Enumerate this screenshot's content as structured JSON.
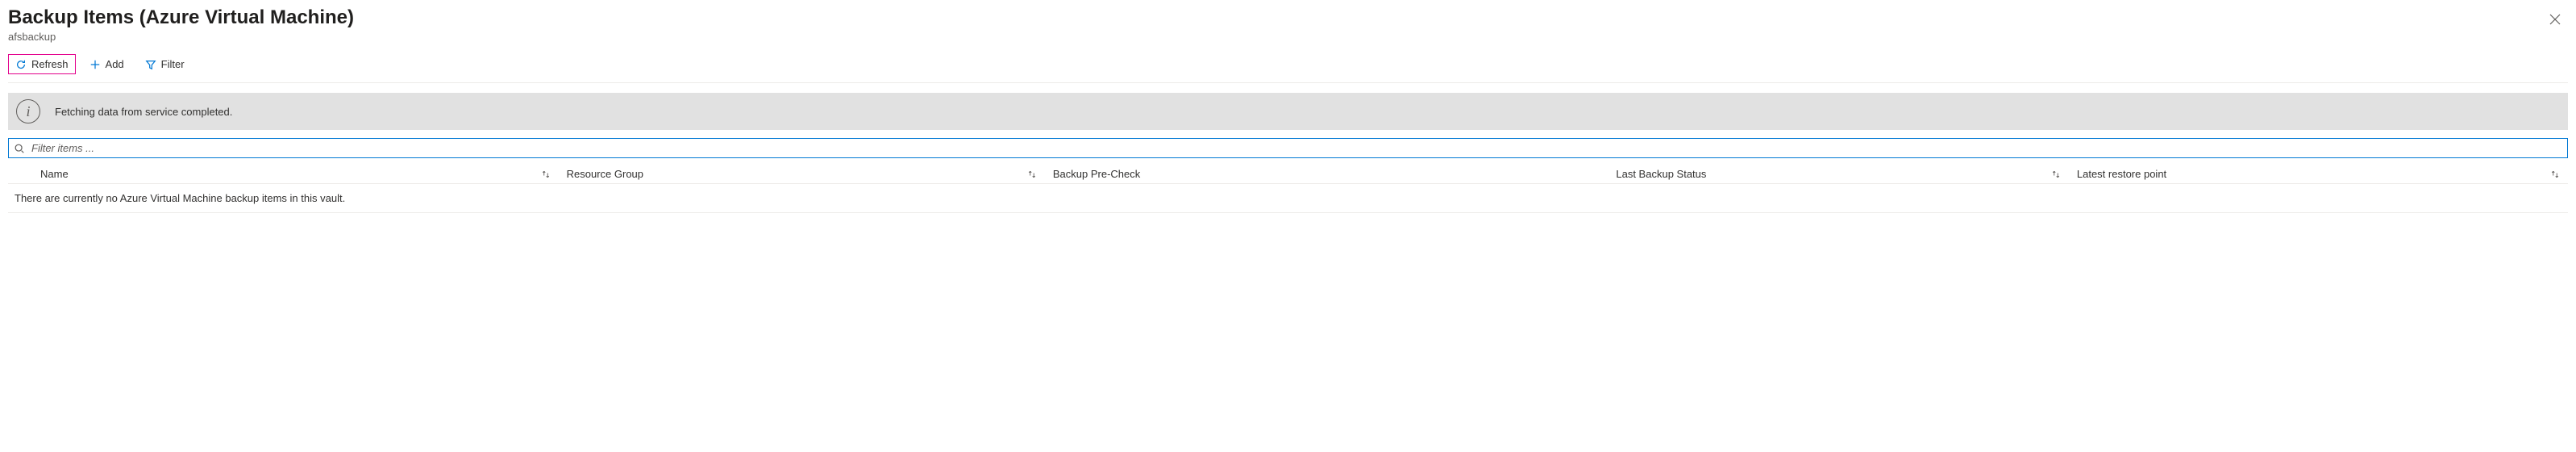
{
  "header": {
    "title": "Backup Items (Azure Virtual Machine)",
    "subtitle": "afsbackup"
  },
  "commands": {
    "refresh": "Refresh",
    "add": "Add",
    "filter": "Filter"
  },
  "banner": {
    "message": "Fetching data from service completed."
  },
  "filter": {
    "placeholder": "Filter items ..."
  },
  "columns": {
    "name": "Name",
    "resource_group": "Resource Group",
    "pre_check": "Backup Pre-Check",
    "last_status": "Last Backup Status",
    "restore_point": "Latest restore point"
  },
  "empty_message": "There are currently no Azure Virtual Machine backup items in this vault."
}
